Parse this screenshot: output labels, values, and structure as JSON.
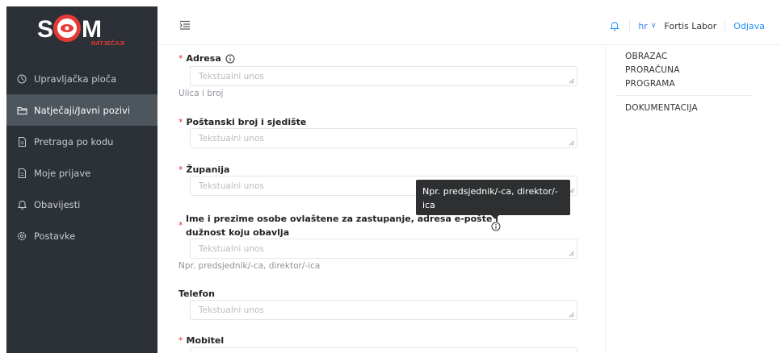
{
  "logo": {
    "text": "SOM",
    "subtitle": "NATJEČAJI"
  },
  "sidebar": {
    "items": [
      {
        "label": "Upravljačka ploča",
        "icon": "gauge-icon"
      },
      {
        "label": "Natječaji/Javni pozivi",
        "icon": "folder-icon",
        "active": true
      },
      {
        "label": "Pretraga po kodu",
        "icon": "document-icon"
      },
      {
        "label": "Moje prijave",
        "icon": "document-icon"
      },
      {
        "label": "Obavijesti",
        "icon": "bell-icon"
      },
      {
        "label": "Postavke",
        "icon": "gear-icon"
      }
    ]
  },
  "header": {
    "lang": "hr",
    "user": "Fortis Labor",
    "logout": "Odjava"
  },
  "form": {
    "adresa": {
      "label": "Adresa",
      "placeholder": "Tekstualni unos",
      "help": "Ulica i broj"
    },
    "postanski": {
      "label": "Poštanski broj i sjedište",
      "placeholder": "Tekstualni unos"
    },
    "zupanija": {
      "label": "Županija",
      "placeholder": "Tekstualni unos"
    },
    "ovlastena": {
      "label_line1": "Ime i prezime osobe ovlaštene za zastupanje, adresa e-pošte i",
      "label_line2": "dužnost koju obavlja",
      "placeholder": "Tekstualni unos",
      "help": "Npr. predsjednik/-ca, direktor/-ica"
    },
    "telefon": {
      "label": "Telefon",
      "placeholder": "Tekstualni unos"
    },
    "mobitel": {
      "label": "Mobitel"
    }
  },
  "tooltip": {
    "line1": "Npr. predsjednik/-ca, direktor/-",
    "line2": "ica"
  },
  "right_panel": {
    "items": [
      "OBRAZAC",
      "PRORAČUNA",
      "PROGRAMA",
      "DOKUMENTACIJA"
    ]
  },
  "colors": {
    "sidebar_bg": "#2b3137",
    "sidebar_active": "#4d555d",
    "logo_red": "#e53935",
    "accent_blue": "#1e90ff",
    "required": "#e53935"
  }
}
